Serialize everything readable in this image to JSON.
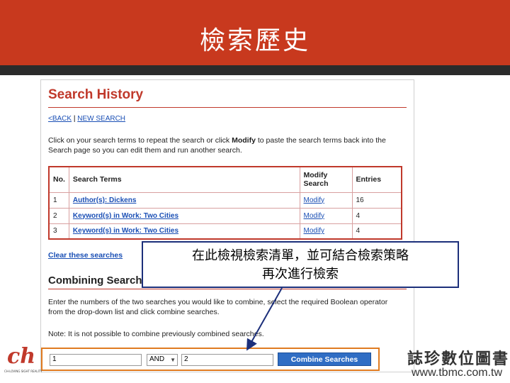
{
  "slide": {
    "title": "檢索歷史",
    "callout_line1": "在此檢視檢索清單，並可結合檢索策略",
    "callout_line2": "再次進行檢索",
    "logo_left_mark": "ch",
    "logo_left_sub": "CH-LOVING SIGHT REALITY",
    "logo_right_cn": "誌珍數位圖書",
    "logo_right_url": "www.tbmc.com.tw"
  },
  "screenshot": {
    "page_title": "Search History",
    "nav": {
      "back": "<BACK",
      "separator": "|",
      "new_search": "NEW SEARCH"
    },
    "intro": {
      "before": "Click on your search terms to repeat the search or click ",
      "bold": "Modify",
      "after": " to paste the search terms back into the Search page so you can edit them and run another search."
    },
    "table": {
      "headers": [
        "No.",
        "Search Terms",
        "Modify Search",
        "Entries"
      ],
      "rows": [
        {
          "no": "1",
          "term": "Author(s): Dickens",
          "modify": "Modify",
          "entries": "16"
        },
        {
          "no": "2",
          "term": "Keyword(s) in Work: Two Cities",
          "modify": "Modify",
          "entries": "4"
        },
        {
          "no": "3",
          "term": "Keyword(s) in Work: Two Cities",
          "modify": "Modify",
          "entries": "4"
        }
      ]
    },
    "clear_link": "Clear these searches",
    "combining": {
      "title": "Combining Searches",
      "instructions": "Enter the numbers of the two searches you would like to combine, select the required Boolean operator from the drop-down list and click combine searches.",
      "note": "Note: It is not possible to combine previously combined searches.",
      "input1_value": "1",
      "operator_value": "AND",
      "input2_value": "2",
      "button_label": "Combine Searches"
    }
  },
  "colors": {
    "header_red": "#c8391e",
    "link_blue": "#1a4fb5",
    "button_blue": "#2f6dc4",
    "highlight_orange": "#e07b20",
    "callout_border": "#1c2f7a"
  }
}
